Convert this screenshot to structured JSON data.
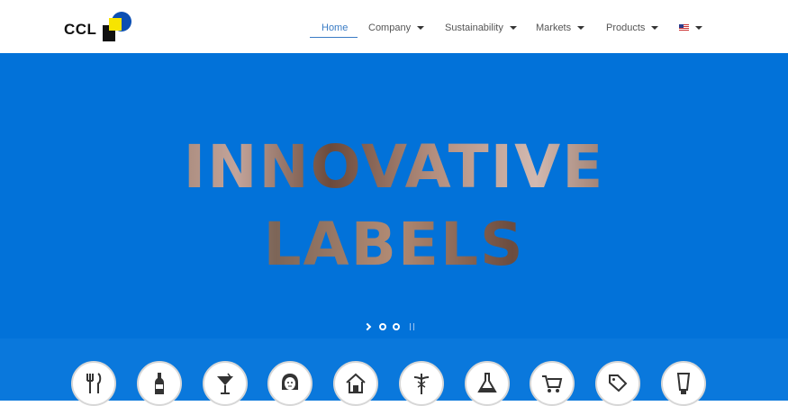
{
  "brand": {
    "logo_text": "CCL",
    "colors": {
      "yellow": "#f7e400",
      "blue": "#0b4fb3",
      "black": "#111111"
    }
  },
  "nav": {
    "items": [
      {
        "label": "Home",
        "active": true
      },
      {
        "label": "Company",
        "dropdown": true
      },
      {
        "label": "Sustainability",
        "dropdown": true
      },
      {
        "label": "Markets",
        "dropdown": true
      },
      {
        "label": "Products",
        "dropdown": true
      }
    ],
    "language_icon": "us-flag-icon"
  },
  "hero": {
    "line1": "INNOVATIVE",
    "line2": "LABELS",
    "background_color": "#0272d9",
    "slides": {
      "count": 2
    }
  },
  "market_icons": [
    "cutlery-icon",
    "bottle-icon",
    "cocktail-icon",
    "face-icon",
    "house-icon",
    "caduceus-icon",
    "flask-icon",
    "cart-icon",
    "tags-icon",
    "tube-icon"
  ]
}
